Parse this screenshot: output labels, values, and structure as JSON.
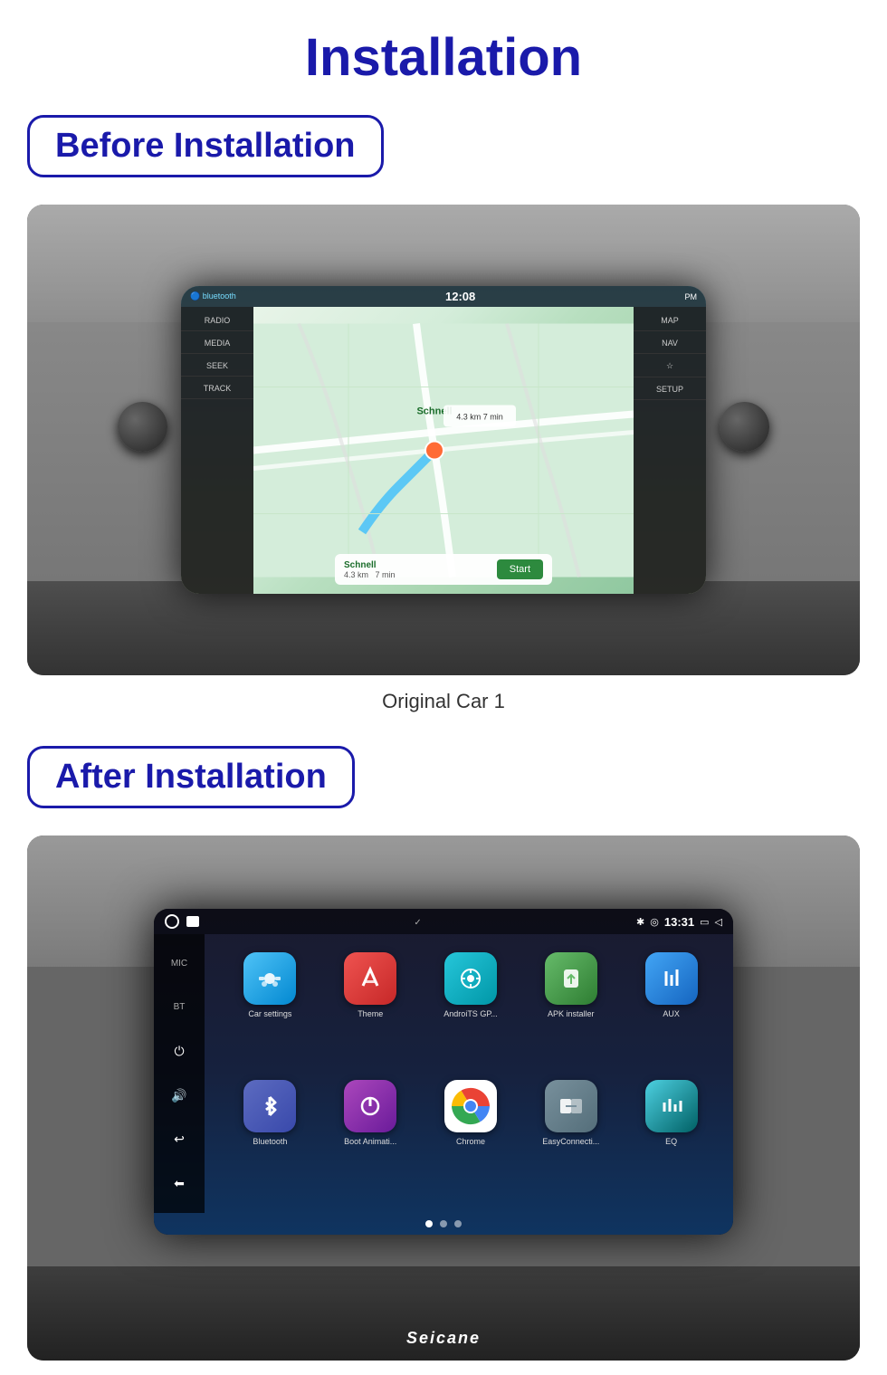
{
  "page": {
    "title": "Installation",
    "before_label": "Before Installation",
    "after_label": "After Installation",
    "caption": "Original Car 1",
    "seicane": "Seicane"
  },
  "before_screen": {
    "time": "12:08",
    "bluetooth_icon": "🔵",
    "nav_buttons_left": [
      "RADIO",
      "MEDIA",
      "SEEK",
      "TRACK"
    ],
    "nav_buttons_right": [
      "MAP",
      "NAV",
      "☆",
      "SETUP"
    ],
    "destination": "Schnell",
    "distance": "4.3 km",
    "duration": "7 min",
    "start_btn": "Start"
  },
  "after_screen": {
    "time": "13:31",
    "apps": [
      {
        "label": "Car settings",
        "class": "app-car-settings",
        "icon": "🚗"
      },
      {
        "label": "Theme",
        "class": "app-theme",
        "icon": "🎨"
      },
      {
        "label": "AndroiTS GP...",
        "class": "app-gps",
        "icon": "📍"
      },
      {
        "label": "APK installer",
        "class": "app-apk",
        "icon": "📦"
      },
      {
        "label": "AUX",
        "class": "app-aux",
        "icon": "🎚"
      },
      {
        "label": "Bluetooth",
        "class": "app-bluetooth",
        "icon": "🔵"
      },
      {
        "label": "Boot Animati...",
        "class": "app-boot",
        "icon": "⏻"
      },
      {
        "label": "Chrome",
        "class": "app-chrome",
        "icon": "🌐"
      },
      {
        "label": "EasyConnecti...",
        "class": "app-easyconnect",
        "icon": "🔗"
      },
      {
        "label": "EQ",
        "class": "app-eq",
        "icon": "📊"
      }
    ],
    "left_btns": [
      "MIC",
      "BT",
      "⏻",
      "🔊",
      "↩",
      "⬅"
    ]
  },
  "colors": {
    "title_blue": "#1a1aaa",
    "border_blue": "#1a1aaa"
  }
}
